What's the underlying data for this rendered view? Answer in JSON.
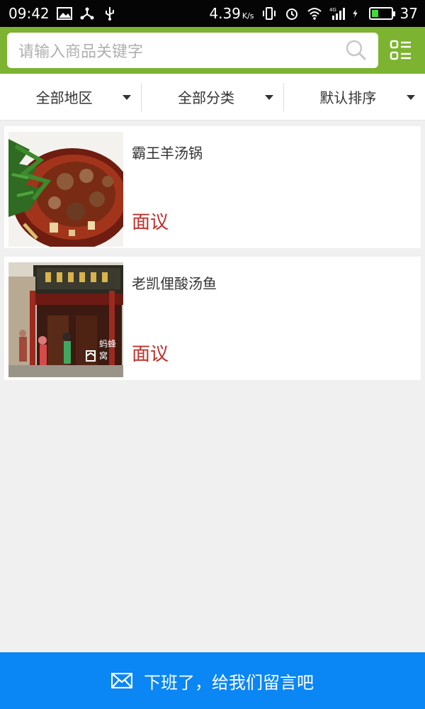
{
  "status_bar": {
    "time": "09:42",
    "network_speed": "4.39",
    "speed_unit": "K/s",
    "signal_label": "4G",
    "battery": "37",
    "icons": [
      "image-icon",
      "share-icon",
      "usb-icon",
      "vibrate-icon",
      "alarm-icon",
      "wifi-icon",
      "signal-icon",
      "charging-icon",
      "battery-icon"
    ]
  },
  "search": {
    "placeholder": "请输入商品关键字",
    "search_icon": "search-icon",
    "menu_icon": "list-menu-icon"
  },
  "filters": [
    {
      "label": "全部地区"
    },
    {
      "label": "全部分类"
    },
    {
      "label": "默认排序"
    }
  ],
  "items": [
    {
      "title": "霸王羊汤锅",
      "price": "面议",
      "image": "lamb-hotpot-photo"
    },
    {
      "title": "老凯俚酸汤鱼",
      "price": "面议",
      "image": "restaurant-storefront-photo",
      "image_watermark": "蚂蜂窝"
    }
  ],
  "footer": {
    "label": "下班了，给我们留言吧",
    "icon": "mail-icon"
  },
  "colors": {
    "header_green": "#7cb331",
    "price_red": "#c0302a",
    "footer_blue": "#0a86f5"
  }
}
